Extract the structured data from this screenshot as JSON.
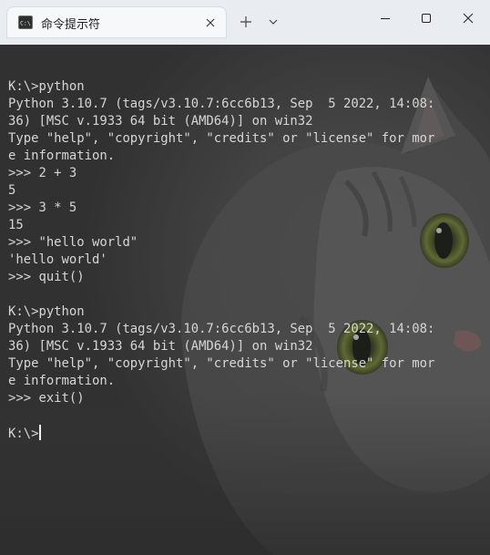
{
  "window": {
    "tab_title": "命令提示符",
    "icon": "cmd-terminal-icon",
    "controls": [
      "minimize-icon",
      "maximize-icon",
      "close-icon"
    ]
  },
  "colors": {
    "titlebar": "#e9ecf0",
    "tab": "#f7f8f9",
    "terminal_bg": "#353535",
    "terminal_text": "#d6d6d6"
  },
  "terminal": {
    "lines": [
      "",
      "K:\\>python",
      "Python 3.10.7 (tags/v3.10.7:6cc6b13, Sep  5 2022, 14:08:",
      "36) [MSC v.1933 64 bit (AMD64)] on win32",
      "Type \"help\", \"copyright\", \"credits\" or \"license\" for mor",
      "e information.",
      ">>> 2 + 3",
      "5",
      ">>> 3 * 5",
      "15",
      ">>> \"hello world\"",
      "'hello world'",
      ">>> quit()",
      "",
      "K:\\>python",
      "Python 3.10.7 (tags/v3.10.7:6cc6b13, Sep  5 2022, 14:08:",
      "36) [MSC v.1933 64 bit (AMD64)] on win32",
      "Type \"help\", \"copyright\", \"credits\" or \"license\" for mor",
      "e information.",
      ">>> exit()",
      ""
    ],
    "prompt": "K:\\>"
  }
}
